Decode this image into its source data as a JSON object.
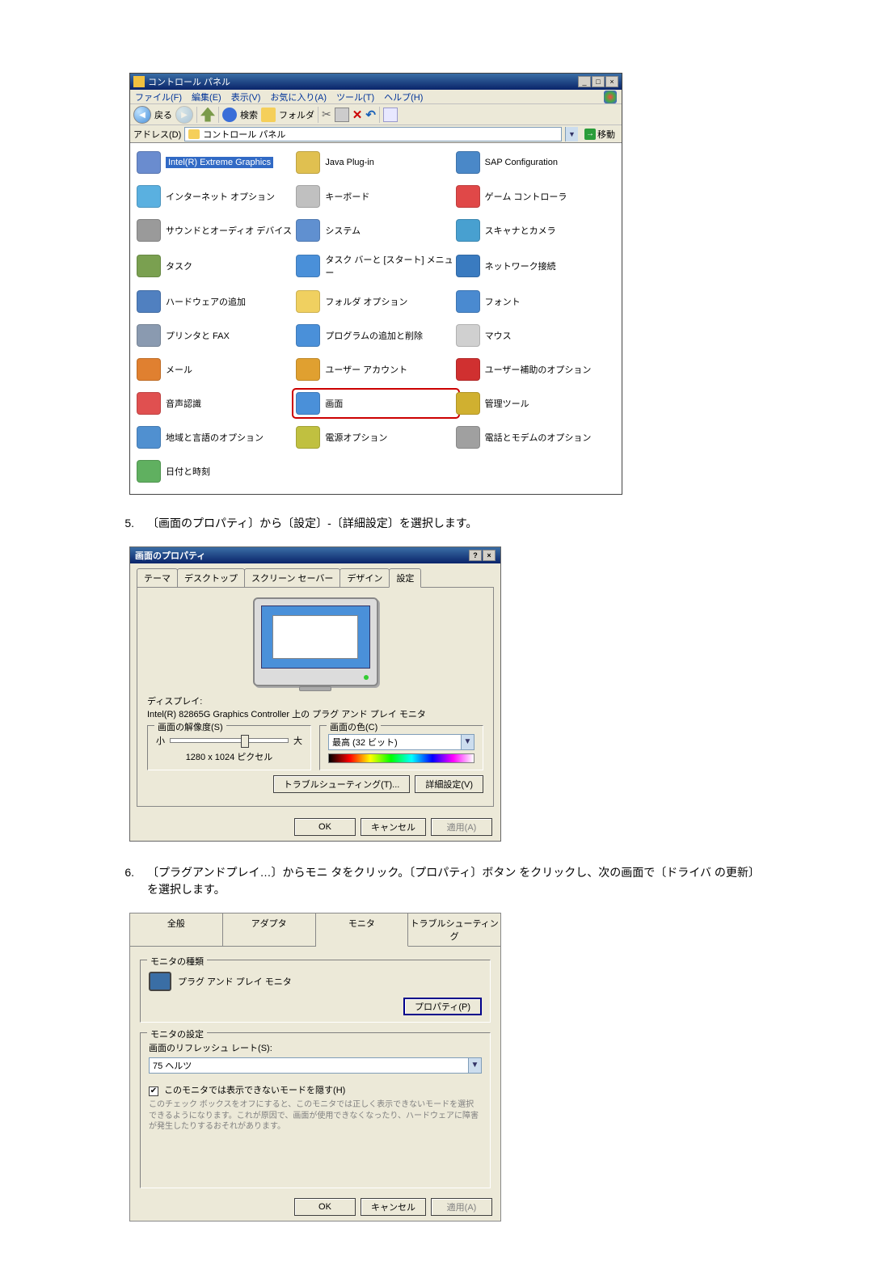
{
  "control_panel": {
    "title": "コントロール パネル",
    "menus": [
      "ファイル(F)",
      "編集(E)",
      "表示(V)",
      "お気に入り(A)",
      "ツール(T)",
      "ヘルプ(H)"
    ],
    "toolbar": {
      "back": "戻る",
      "search": "検索",
      "folders": "フォルダ"
    },
    "address": {
      "label": "アドレス(D)",
      "value": "コントロール パネル",
      "go": "移動"
    },
    "items": [
      {
        "label": "Intel(R) Extreme Graphics",
        "color": "#6a8ccf",
        "selected": true
      },
      {
        "label": "Java Plug-in",
        "color": "#e0c050"
      },
      {
        "label": "SAP Configuration",
        "color": "#4a88c8"
      },
      {
        "label": "インターネット オプション",
        "color": "#5ab0e0"
      },
      {
        "label": "キーボード",
        "color": "#c0c0c0"
      },
      {
        "label": "ゲーム コントローラ",
        "color": "#e04848"
      },
      {
        "label": "サウンドとオーディオ デバイス",
        "color": "#9a9a9a"
      },
      {
        "label": "システム",
        "color": "#6090d0"
      },
      {
        "label": "スキャナとカメラ",
        "color": "#48a0d0"
      },
      {
        "label": "タスク",
        "color": "#7aa050"
      },
      {
        "label": "タスク バーと [スタート] メニュー",
        "color": "#4a90d9"
      },
      {
        "label": "ネットワーク接続",
        "color": "#3a7bc0"
      },
      {
        "label": "ハードウェアの追加",
        "color": "#5080c0"
      },
      {
        "label": "フォルダ オプション",
        "color": "#f0d060"
      },
      {
        "label": "フォント",
        "color": "#4a8ad0"
      },
      {
        "label": "プリンタと FAX",
        "color": "#8a9ab0"
      },
      {
        "label": "プログラムの追加と削除",
        "color": "#4a90d9"
      },
      {
        "label": "マウス",
        "color": "#d0d0d0"
      },
      {
        "label": "メール",
        "color": "#e08030"
      },
      {
        "label": "ユーザー アカウント",
        "color": "#e0a030"
      },
      {
        "label": "ユーザー補助のオプション",
        "color": "#d03030"
      },
      {
        "label": "音声認識",
        "color": "#e05050"
      },
      {
        "label": "画面",
        "color": "#4a90d9",
        "highlight": true
      },
      {
        "label": "管理ツール",
        "color": "#d0b030"
      },
      {
        "label": "地域と言語のオプション",
        "color": "#5090d0"
      },
      {
        "label": "電源オプション",
        "color": "#c0c040"
      },
      {
        "label": "電話とモデムのオプション",
        "color": "#a0a0a0"
      },
      {
        "label": "日付と時刻",
        "color": "#60b060",
        "span_last": true
      }
    ]
  },
  "step5": {
    "num": "5.",
    "text": "〔画面のプロパティ〕から〔設定〕-〔詳細設定〕を選択します。"
  },
  "disp_props": {
    "title": "画面のプロパティ",
    "tabs": [
      "テーマ",
      "デスクトップ",
      "スクリーン セーバー",
      "デザイン",
      "設定"
    ],
    "active_tab": 4,
    "display_label": "ディスプレイ:",
    "display_value": "Intel(R) 82865G Graphics Controller 上の プラグ アンド プレイ モニタ",
    "res_group": "画面の解像度(S)",
    "res_small": "小",
    "res_large": "大",
    "res_value": "1280 x 1024 ピクセル",
    "color_group": "画面の色(C)",
    "color_value": "最高 (32 ビット)",
    "trouble_btn": "トラブルシューティング(T)...",
    "adv_btn": "詳細設定(V)",
    "ok": "OK",
    "cancel": "キャンセル",
    "apply": "適用(A)"
  },
  "step6": {
    "num": "6.",
    "text": "〔プラグアンドプレイ…〕からモニ タをクリック。〔プロパティ〕ボタン をクリックし、次の画面で〔ドライバ の更新〕を選択します。"
  },
  "monitor_dlg": {
    "tabs": [
      "全般",
      "アダプタ",
      "モニタ",
      "トラブルシューティング"
    ],
    "active_tab": 2,
    "type_group": "モニタの種類",
    "type_value": "プラグ アンド プレイ モニタ",
    "props_btn": "プロパティ(P)",
    "settings_group": "モニタの設定",
    "refresh_label": "画面のリフレッシュ レート(S):",
    "refresh_value": "75 ヘルツ",
    "hide_check": "このモニタでは表示できないモードを隠す(H)",
    "note": "このチェック ボックスをオフにすると、このモニタでは正しく表示できないモードを選択できるようになります。これが原因で、画面が使用できなくなったり、ハードウェアに障害が発生したりするおそれがあります。",
    "ok": "OK",
    "cancel": "キャンセル",
    "apply": "適用(A)"
  }
}
